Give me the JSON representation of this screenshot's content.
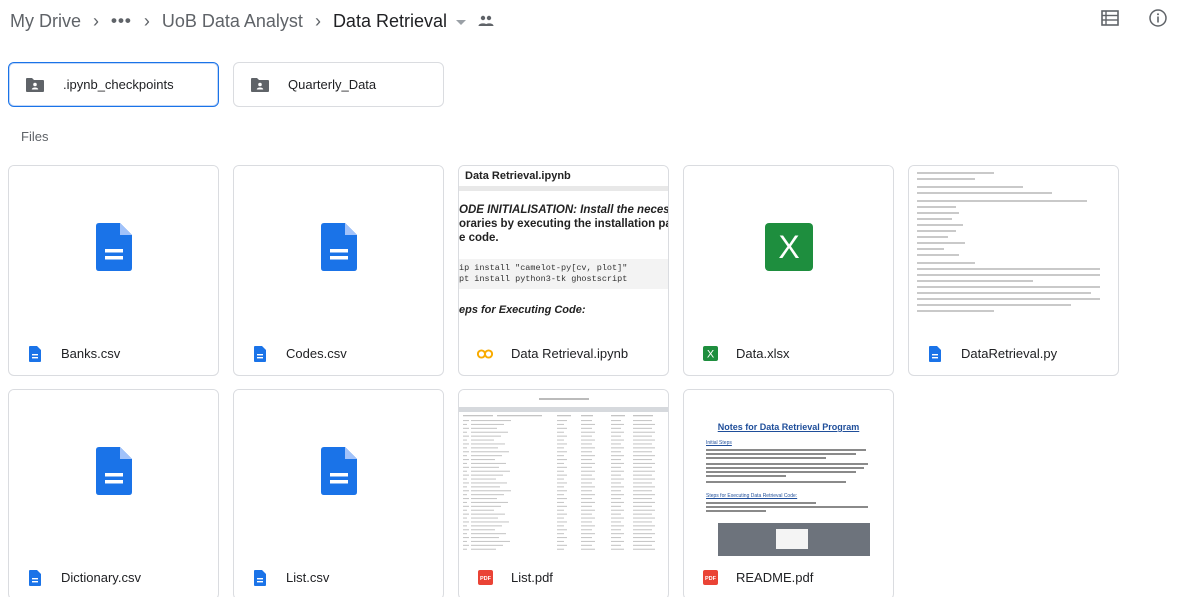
{
  "breadcrumb": {
    "root": "My Drive",
    "ellipsis": "•••",
    "parent": "UoB Data Analyst",
    "current": "Data Retrieval"
  },
  "header_icons": [
    "list-view-icon",
    "info-icon"
  ],
  "folders": [
    {
      "name": ".ipynb_checkpoints",
      "icon": "shared-folder-icon",
      "selected": true
    },
    {
      "name": "Quarterly_Data",
      "icon": "shared-folder-icon",
      "selected": false
    }
  ],
  "files_label": "Files",
  "files": [
    {
      "name": "Banks.csv",
      "type": "doc"
    },
    {
      "name": "Codes.csv",
      "type": "doc"
    },
    {
      "name": "Data Retrieval.ipynb",
      "type": "colab"
    },
    {
      "name": "Data.xlsx",
      "type": "excel"
    },
    {
      "name": "DataRetrieval.py",
      "type": "doc"
    },
    {
      "name": "Dictionary.csv",
      "type": "doc"
    },
    {
      "name": "List.csv",
      "type": "doc"
    },
    {
      "name": "List.pdf",
      "type": "pdf"
    },
    {
      "name": "README.pdf",
      "type": "pdf"
    }
  ],
  "notebook_preview": {
    "title": "Data Retrieval.ipynb",
    "heading_line1": "ODE INITIALISATION: Install the necessar",
    "heading_line2": "oraries by executing the installation part o",
    "heading_line3": "e code.",
    "code_line1": "ip install \"camelot-py[cv, plot]\"",
    "code_line2": "pt install python3-tk ghostscript",
    "steps": "eps for Executing Code:"
  },
  "readme_preview": {
    "title": "Notes for Data Retrieval Program",
    "section1": "Initial Steps",
    "section2": "Steps for Executing Data Retrieval Code:"
  },
  "excel_letter": "X",
  "pdf_label": "PDF",
  "colab_label": "CO",
  "colors": {
    "doc_blue": "#1a73e8",
    "excel_green": "#1e8e3e",
    "pdf_red": "#ea4335",
    "colab_orange": "#f9ab00",
    "selected_border": "#1a73e8"
  }
}
